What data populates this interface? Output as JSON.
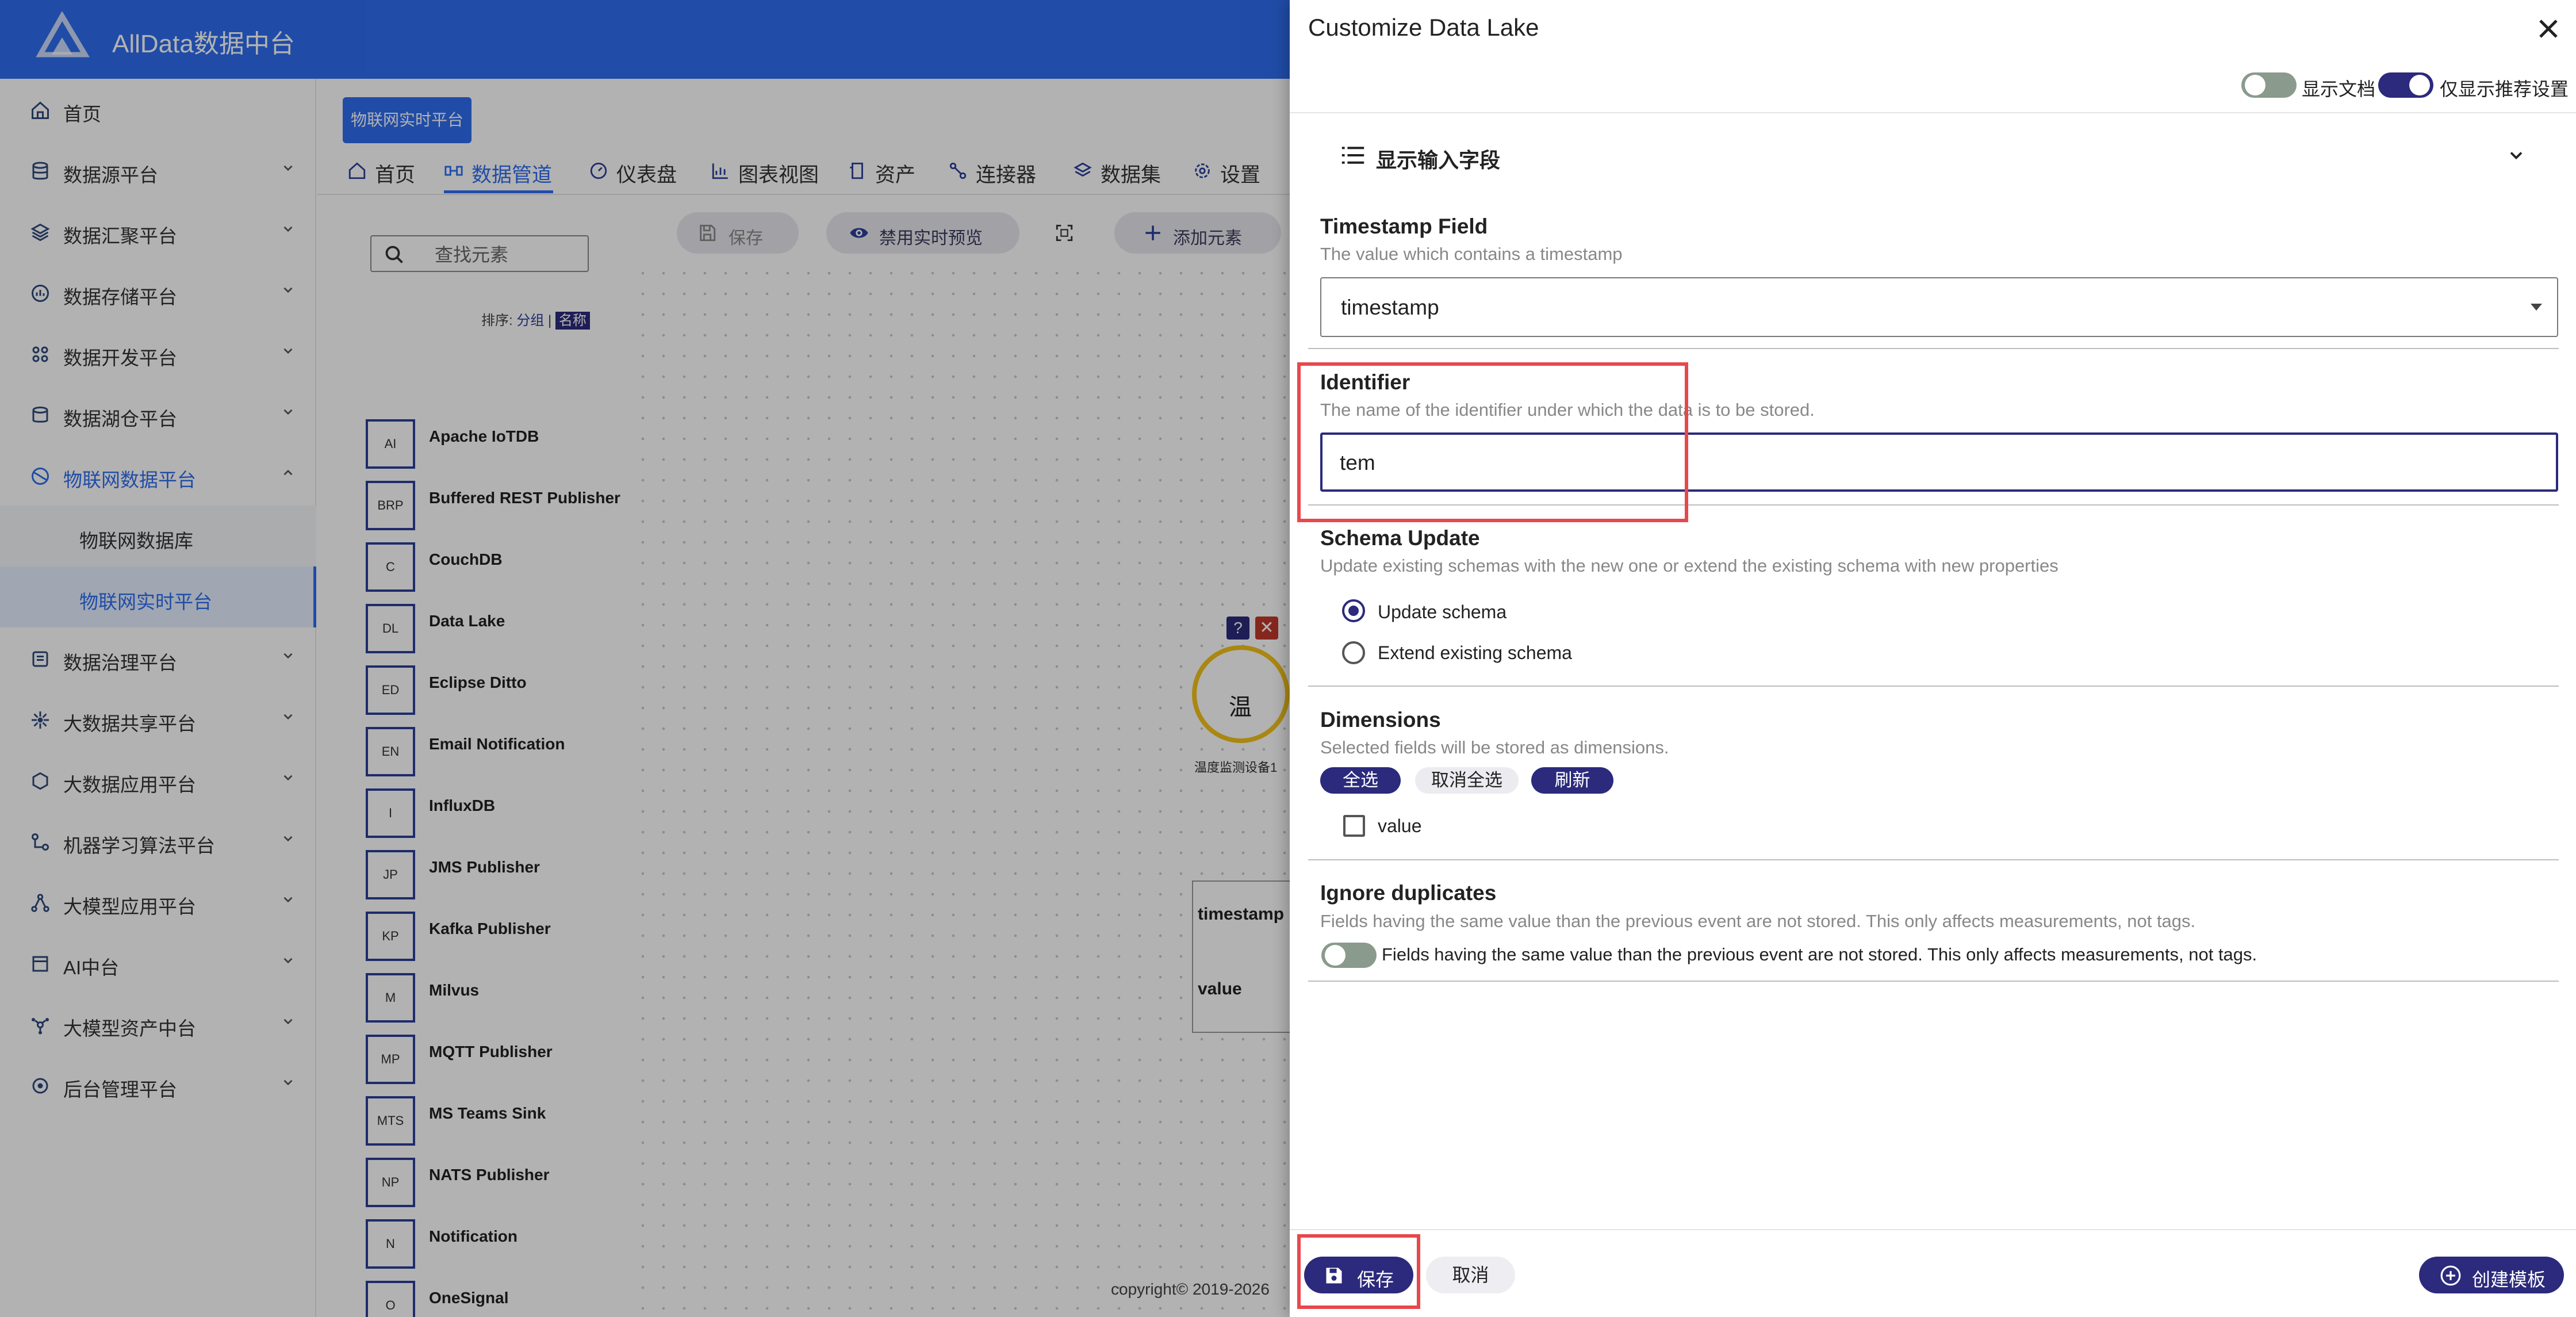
{
  "app": {
    "title": "AllData数据中台"
  },
  "sidebar": {
    "items": [
      {
        "label": "首页",
        "icon": "home-icon"
      },
      {
        "label": "数据源平台",
        "icon": "database-icon"
      },
      {
        "label": "数据汇聚平台",
        "icon": "layers-icon"
      },
      {
        "label": "数据存储平台",
        "icon": "storage-icon"
      },
      {
        "label": "数据开发平台",
        "icon": "code-icon"
      },
      {
        "label": "数据湖仓平台",
        "icon": "lake-icon"
      },
      {
        "label": "物联网数据平台",
        "icon": "iot-icon",
        "expanded": true
      },
      {
        "label": "数据治理平台",
        "icon": "governance-icon"
      },
      {
        "label": "大数据共享平台",
        "icon": "share-icon"
      },
      {
        "label": "大数据应用平台",
        "icon": "app-icon"
      },
      {
        "label": "机器学习算法平台",
        "icon": "ml-icon"
      },
      {
        "label": "大模型应用平台",
        "icon": "model-icon"
      },
      {
        "label": "AI中台",
        "icon": "ai-icon"
      },
      {
        "label": "大模型资产中台",
        "icon": "asset-icon"
      },
      {
        "label": "后台管理平台",
        "icon": "admin-icon"
      }
    ],
    "subitems": [
      {
        "label": "物联网数据库"
      },
      {
        "label": "物联网实时平台",
        "active": true
      }
    ]
  },
  "main": {
    "platform_chip": "物联网实时平台",
    "tabs": [
      {
        "label": "首页",
        "icon": "home-icon"
      },
      {
        "label": "数据管道",
        "icon": "pipeline-icon",
        "active": true
      },
      {
        "label": "仪表盘",
        "icon": "dashboard-icon"
      },
      {
        "label": "图表视图",
        "icon": "chart-icon"
      },
      {
        "label": "资产",
        "icon": "asset-icon"
      },
      {
        "label": "连接器",
        "icon": "connector-icon"
      },
      {
        "label": "数据集",
        "icon": "dataset-icon"
      },
      {
        "label": "设置",
        "icon": "settings-icon"
      }
    ],
    "search_placeholder": "查找元素",
    "toolbar": {
      "save": "保存",
      "disable_preview": "禁用实时预览",
      "add_element": "添加元素"
    },
    "sort": {
      "prefix": "排序:",
      "group": "分组",
      "divider": "|",
      "name": "名称"
    },
    "elements": [
      {
        "abbr": "AI",
        "name": "Apache IoTDB"
      },
      {
        "abbr": "BRP",
        "name": "Buffered REST Publisher"
      },
      {
        "abbr": "C",
        "name": "CouchDB"
      },
      {
        "abbr": "DL",
        "name": "Data Lake"
      },
      {
        "abbr": "ED",
        "name": "Eclipse Ditto"
      },
      {
        "abbr": "EN",
        "name": "Email Notification"
      },
      {
        "abbr": "I",
        "name": "InfluxDB"
      },
      {
        "abbr": "JP",
        "name": "JMS Publisher"
      },
      {
        "abbr": "KP",
        "name": "Kafka Publisher"
      },
      {
        "abbr": "M",
        "name": "Milvus"
      },
      {
        "abbr": "MP",
        "name": "MQTT Publisher"
      },
      {
        "abbr": "MTS",
        "name": "MS Teams Sink"
      },
      {
        "abbr": "NP",
        "name": "NATS Publisher"
      },
      {
        "abbr": "N",
        "name": "Notification"
      },
      {
        "abbr": "O",
        "name": "OneSignal"
      }
    ],
    "node": {
      "help": "?",
      "close": "✕",
      "glyph": "温",
      "caption": "温度监测设备1",
      "fields": [
        "timestamp",
        "value"
      ]
    },
    "copyright": "copyright© 2019-2026 "
  },
  "drawer": {
    "title": "Customize Data Lake",
    "toggles": {
      "show_docs": {
        "label": "显示文档",
        "on": false
      },
      "recommended_only": {
        "label": "仅显示推荐设置",
        "on": true
      }
    },
    "show_input_fields": "显示输入字段",
    "timestamp": {
      "title": "Timestamp Field",
      "desc": "The value which contains a timestamp",
      "value": "timestamp"
    },
    "identifier": {
      "title": "Identifier",
      "desc": "The name of the identifier under which the data is to be stored.",
      "value": "tem"
    },
    "schema_update": {
      "title": "Schema Update",
      "desc": "Update existing schemas with the new one or extend the existing schema with new properties",
      "options": [
        {
          "label": "Update schema",
          "checked": true
        },
        {
          "label": "Extend existing schema",
          "checked": false
        }
      ]
    },
    "dimensions": {
      "title": "Dimensions",
      "desc": "Selected fields will be stored as dimensions.",
      "select_all": "全选",
      "deselect_all": "取消全选",
      "refresh": "刷新",
      "fields": [
        {
          "label": "value",
          "checked": false
        }
      ]
    },
    "ignore_duplicates": {
      "title": "Ignore duplicates",
      "desc": "Fields having the same value than the previous event are not stored. This only affects measurements, not tags.",
      "toggle_label": "Fields having the same value than the previous event are not stored. This only affects measurements, not tags.",
      "on": false
    },
    "footer": {
      "save": "保存",
      "cancel": "取消",
      "create_template": "创建模板"
    }
  },
  "colors": {
    "brand_blue": "#2f6df0",
    "accent_navy": "#2b2a7c",
    "highlight_red": "#e8474c"
  }
}
